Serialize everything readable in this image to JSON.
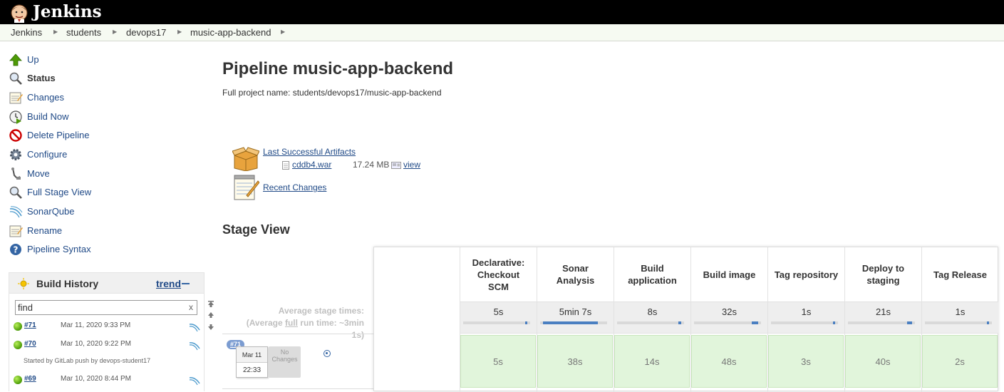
{
  "header": {
    "logo_text": "Jenkins"
  },
  "breadcrumbs": [
    "Jenkins",
    "students",
    "devops17",
    "music-app-backend"
  ],
  "sidebar": {
    "tasks": [
      {
        "label": "Up",
        "icon": "up-arrow-icon"
      },
      {
        "label": "Status",
        "icon": "magnifier-icon"
      },
      {
        "label": "Changes",
        "icon": "notepad-icon"
      },
      {
        "label": "Build Now",
        "icon": "clock-play-icon"
      },
      {
        "label": "Delete Pipeline",
        "icon": "no-entry-icon"
      },
      {
        "label": "Configure",
        "icon": "gear-icon"
      },
      {
        "label": "Move",
        "icon": "move-icon"
      },
      {
        "label": "Full Stage View",
        "icon": "magnifier-icon"
      },
      {
        "label": "SonarQube",
        "icon": "sonarqube-icon"
      },
      {
        "label": "Rename",
        "icon": "notepad-icon"
      },
      {
        "label": "Pipeline Syntax",
        "icon": "help-icon"
      }
    ]
  },
  "build_history": {
    "title": "Build History",
    "trend": "trend",
    "search": {
      "value": "find",
      "clear": "x"
    },
    "builds": [
      {
        "number": "#71",
        "date": "Mar 11, 2020 9:33 PM"
      },
      {
        "number": "#70",
        "date": "Mar 10, 2020 9:22 PM",
        "note": "Started by GitLab push by devops-student17"
      },
      {
        "number": "#69",
        "date": "Mar 10, 2020 8:44 PM"
      }
    ]
  },
  "main": {
    "title": "Pipeline music-app-backend",
    "full_name": "Full project name: students/devops17/music-app-backend",
    "artifacts_label": "Last Successful Artifacts",
    "artifact": {
      "name": "cddb4.war",
      "size": "17.24 MB",
      "view": "view"
    },
    "recent_changes": "Recent Changes"
  },
  "stage_view": {
    "title": "Stage View",
    "avg_line1": "Average stage times:",
    "avg_line2_pre": "(Average ",
    "avg_full": "full",
    "avg_line2_post": " run time: ~3min",
    "avg_line3": "1s)",
    "run": {
      "badge": "#71",
      "date": "Mar 11",
      "time": "22:33",
      "no_changes": "No Changes"
    },
    "stages": [
      {
        "name": "Declarative: Checkout SCM",
        "avg": "5s",
        "avg_fraction": 0.03,
        "run": "5s"
      },
      {
        "name": "Sonar Analysis",
        "avg": "5min 7s",
        "avg_fraction": 0.82,
        "run": "38s"
      },
      {
        "name": "Build application",
        "avg": "8s",
        "avg_fraction": 0.04,
        "run": "14s"
      },
      {
        "name": "Build image",
        "avg": "32s",
        "avg_fraction": 0.1,
        "run": "48s"
      },
      {
        "name": "Tag repository",
        "avg": "1s",
        "avg_fraction": 0.01,
        "run": "3s"
      },
      {
        "name": "Deploy to staging",
        "avg": "21s",
        "avg_fraction": 0.07,
        "run": "40s"
      },
      {
        "name": "Tag Release",
        "avg": "1s",
        "avg_fraction": 0.01,
        "run": "2s"
      }
    ]
  }
}
